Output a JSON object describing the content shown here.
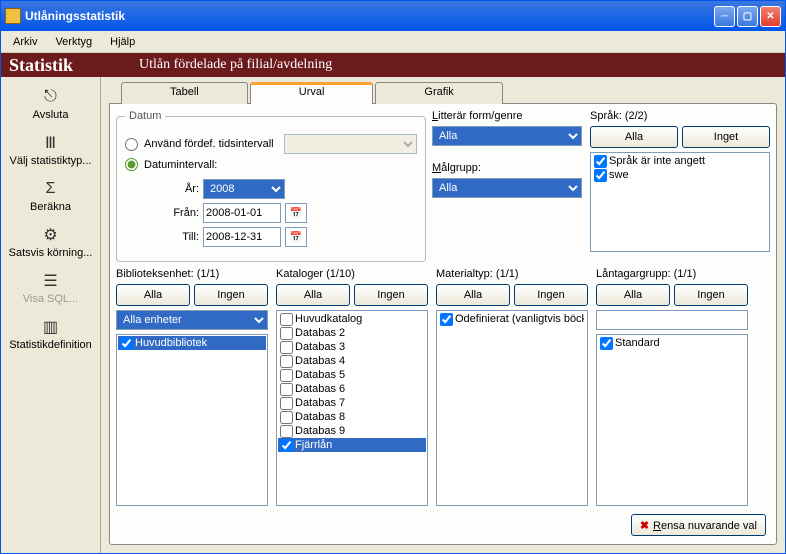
{
  "window": {
    "title": "Utlåningsstatistik"
  },
  "menu": {
    "arkiv": "Arkiv",
    "verktyg": "Verktyg",
    "hjalp": "Hjälp"
  },
  "header": {
    "title": "Statistik",
    "subtitle": "Utlån fördelade på filial/avdelning"
  },
  "sidebar": {
    "avsluta": "Avsluta",
    "valj": "Välj statistiktyp...",
    "berakna": "Beräkna",
    "satsvis": "Satsvis körning...",
    "visasql": "Visa SQL...",
    "statdef": "Statistikdefinition"
  },
  "tabs": {
    "tabell": "Tabell",
    "urval": "Urval",
    "grafik": "Grafik"
  },
  "datum": {
    "legend": "Datum",
    "predef_label": "Använd fördef. tidsintervall",
    "interval_label": "Datumintervall:",
    "ar_label": "År:",
    "ar_value": "2008",
    "fran_label": "Från:",
    "fran_value": "2008-01-01",
    "till_label": "Till:",
    "till_value": "2008-12-31"
  },
  "littform": {
    "label": "Litterär form/genre",
    "value": "Alla"
  },
  "malgrupp": {
    "label": "Målgrupp:",
    "value": "Alla"
  },
  "sprak": {
    "label": "Språk: (2/2)",
    "alla": "Alla",
    "inget": "Inget",
    "items": [
      "Språk är inte angett",
      "swe"
    ]
  },
  "biblio": {
    "label": "Biblioteksenhet: (1/1)",
    "alla": "Alla",
    "ingen": "Ingen",
    "combo": "Alla enheter",
    "item0": "Huvudbibliotek"
  },
  "katalog": {
    "label": "Kataloger (1/10)",
    "alla": "Alla",
    "ingen": "Ingen",
    "items": [
      "Huvudkatalog",
      "Databas 2",
      "Databas 3",
      "Databas 4",
      "Databas 5",
      "Databas 6",
      "Databas 7",
      "Databas 8",
      "Databas 9",
      "Fjärrlån"
    ]
  },
  "material": {
    "label": "Materialtyp: (1/1)",
    "alla": "Alla",
    "ingen": "Ingen",
    "item0": "Odefinierat (vanligtvis böck"
  },
  "lantagar": {
    "label": "Låntagargrupp: (1/1)",
    "alla": "Alla",
    "ingen": "Ingen",
    "item0": "Standard"
  },
  "footer": {
    "reset": "Rensa nuvarande val"
  }
}
